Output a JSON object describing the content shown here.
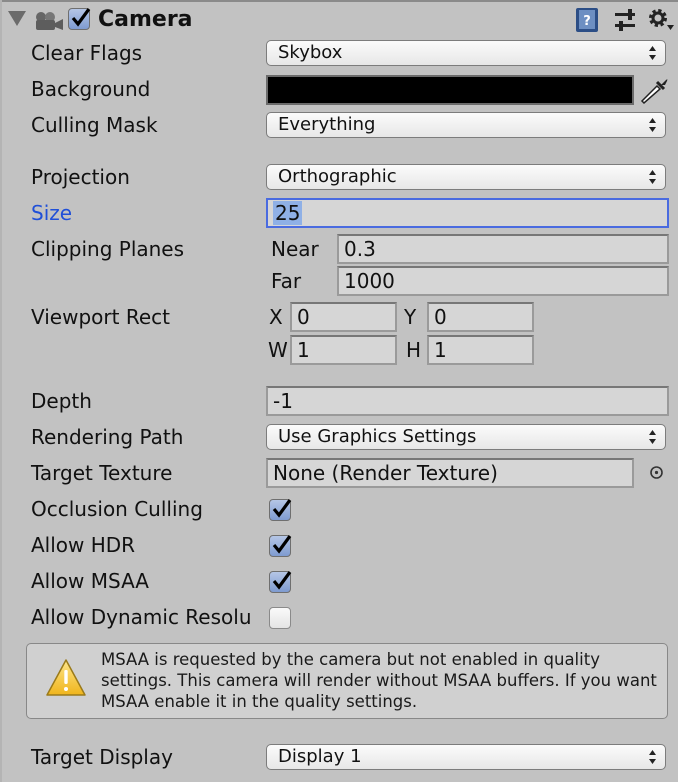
{
  "header": {
    "title": "Camera",
    "enabled": true,
    "icons": [
      "foldout-triangle-icon",
      "camera-icon",
      "help-book-icon",
      "preset-sliders-icon",
      "gear-icon"
    ]
  },
  "fields": {
    "clear_flags": {
      "label": "Clear Flags",
      "value": "Skybox"
    },
    "background": {
      "label": "Background",
      "color": "#000000"
    },
    "culling_mask": {
      "label": "Culling Mask",
      "value": "Everything"
    },
    "projection": {
      "label": "Projection",
      "value": "Orthographic"
    },
    "size": {
      "label": "Size",
      "value": "25"
    },
    "clipping_planes": {
      "label": "Clipping Planes",
      "near_label": "Near",
      "near": "0.3",
      "far_label": "Far",
      "far": "1000"
    },
    "viewport_rect": {
      "label": "Viewport Rect",
      "x_label": "X",
      "x": "0",
      "y_label": "Y",
      "y": "0",
      "w_label": "W",
      "w": "1",
      "h_label": "H",
      "h": "1"
    },
    "depth": {
      "label": "Depth",
      "value": "-1"
    },
    "rendering_path": {
      "label": "Rendering Path",
      "value": "Use Graphics Settings"
    },
    "target_texture": {
      "label": "Target Texture",
      "value": "None (Render Texture)"
    },
    "occlusion_culling": {
      "label": "Occlusion Culling",
      "checked": true
    },
    "allow_hdr": {
      "label": "Allow HDR",
      "checked": true
    },
    "allow_msaa": {
      "label": "Allow MSAA",
      "checked": true
    },
    "allow_dynamic_resolution": {
      "label": "Allow Dynamic Resolu",
      "checked": false
    },
    "target_display": {
      "label": "Target Display",
      "value": "Display 1"
    }
  },
  "warning": {
    "text": "MSAA is requested by the camera but not enabled in quality settings. This camera will render without MSAA buffers. If you want MSAA enable it in the quality settings."
  },
  "colors": {
    "focus": "#4a6be0",
    "label_active": "#1f4fd8",
    "checkbox_on": "#7e9bd0"
  }
}
